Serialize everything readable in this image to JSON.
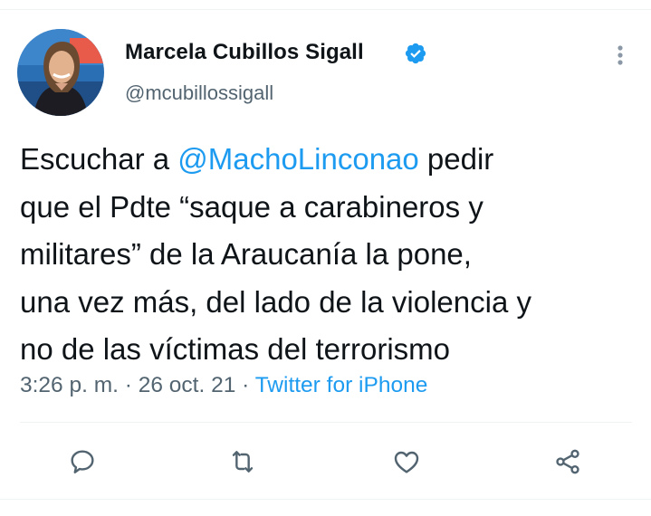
{
  "author": {
    "display_name": "Marcela Cubillos Sigall",
    "handle": "@mcubillossigall",
    "verified": true
  },
  "tweet": {
    "lines": [
      {
        "before": "Escuchar a ",
        "mention": "@MachoLinconao",
        "after": " pedir"
      },
      {
        "text": "que el Pdte “saque a carabineros y"
      },
      {
        "text": "militares” de la Araucanía la pone,"
      },
      {
        "text": "una vez más, del lado de la violencia y"
      },
      {
        "text": "no de las víctimas del terrorismo"
      }
    ]
  },
  "meta": {
    "time": "3:26 p. m.",
    "separator_1": " · ",
    "date": "26 oct. 21",
    "separator_2": " · ",
    "source": "Twitter for iPhone"
  },
  "actions": [
    {
      "name": "reply-icon"
    },
    {
      "name": "retweet-icon"
    },
    {
      "name": "like-icon"
    },
    {
      "name": "share-icon"
    }
  ],
  "colors": {
    "accent": "#1d9bf0",
    "text": "#0f1419",
    "secondary": "#536471",
    "divider": "#eff3f4"
  }
}
